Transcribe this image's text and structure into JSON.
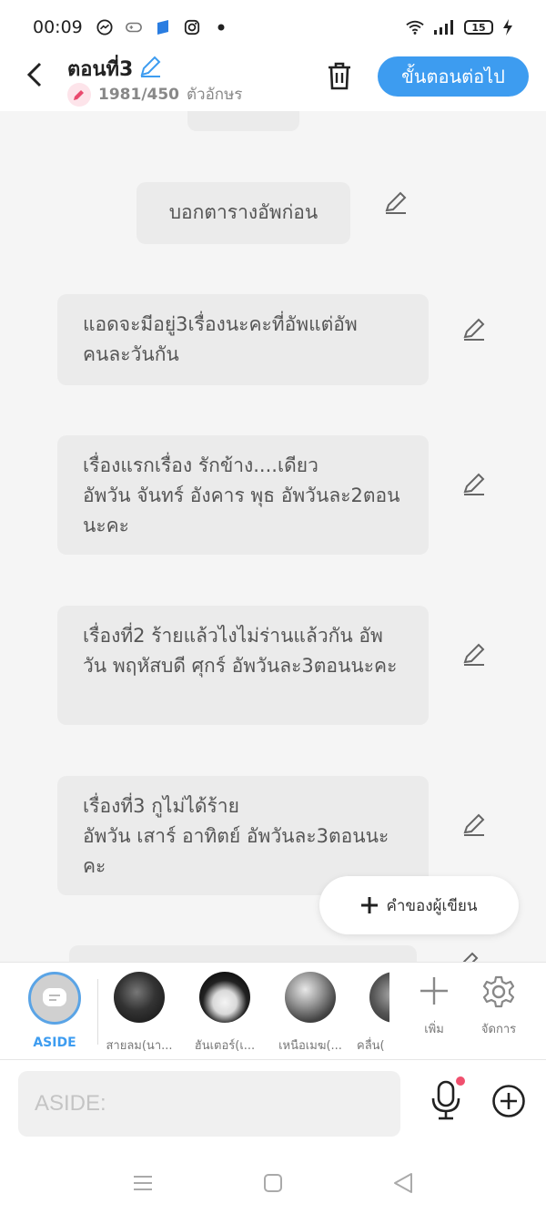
{
  "status_bar": {
    "time": "00:09",
    "battery": "15"
  },
  "header": {
    "title": "ตอนที่3",
    "char_count": "1981/450",
    "char_unit": "ตัวอักษร",
    "next_label": "ขั้นตอนต่อไป"
  },
  "messages": [
    "บอกตารางอัพก่อน",
    "แอดจะมีอยู่3เรื่องนะคะที่อัพแต่อัพคนละวันกัน",
    "เรื่องแรกเรื่อง รักข้าง....เดียว\nอัพวัน จันทร์ อังคาร พุธ อัพวันละ2ตอนนะคะ",
    "เรื่องที่2 ร้ายแล้วไงไม่ร่านแล้วกัน อัพวัน พฤหัสบดี ศุกร์ อัพวันละ3ตอนนะคะ",
    "เรื่องที่3 กูไม่ได้ร้าย\nอัพวัน เสาร์ อาทิตย์ อัพวันละ3ตอนนะคะ"
  ],
  "writer_note_label": "คำของผู้เขียน",
  "characters": {
    "aside": "ASIDE",
    "items": [
      "สายลม(นา...",
      "ฮันเตอร์(เ...",
      "เหนือเมฆ(...",
      "คลื่น("
    ]
  },
  "tools": {
    "add_label": "เพิ่ม",
    "manage_label": "จัดการ"
  },
  "composer": {
    "placeholder": "ASIDE:"
  },
  "colors": {
    "accent": "#3d9cf0",
    "bubble": "#ebebeb",
    "background": "#f5f5f5",
    "mic_dot": "#f0506e"
  }
}
